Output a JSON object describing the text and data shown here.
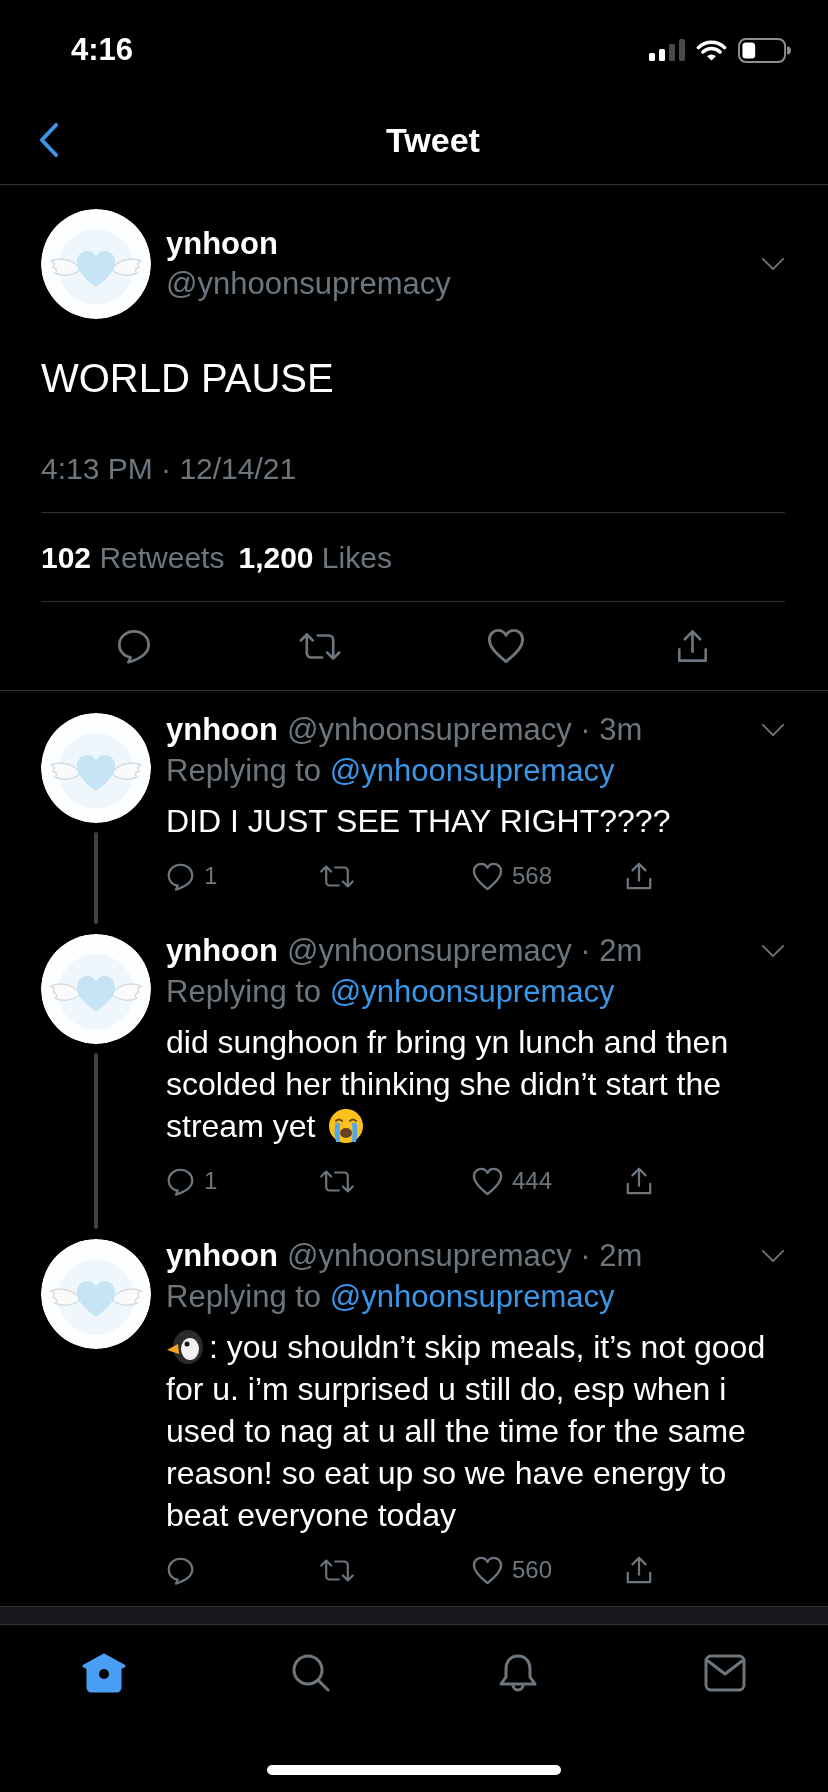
{
  "status_bar": {
    "time": "4:16"
  },
  "nav_bar": {
    "title": "Tweet"
  },
  "tweet": {
    "name": "ynhoon",
    "handle": "@ynhoonsupremacy",
    "text": "WORLD PAUSE",
    "timestamp": "4:13 PM · 12/14/21",
    "retweets": "**102** Retweets",
    "likes": "**1,200** Likes"
  },
  "replies": [
    {
      "name": "ynhoon",
      "meta": "@ynhoonsupremacy · 3m",
      "replying_to": "Replying to",
      "mention": "@ynhoonsupremacy",
      "content": [
        {
          "kind": "text",
          "text": "DID I JUST SEE THAY RIGHT????"
        }
      ],
      "reply_count": "1",
      "like_count": "568",
      "thread_continues": true
    },
    {
      "name": "ynhoon",
      "meta": "@ynhoonsupremacy · 2m",
      "replying_to": "Replying to",
      "mention": "@ynhoonsupremacy",
      "content": [
        {
          "kind": "text",
          "text": "did sunghoon fr bring yn lunch and then scolded her thinking she didn’t start the"
        },
        {
          "kind": "text",
          "text": "stream yet"
        },
        {
          "kind": "crying-face"
        }
      ],
      "reply_count": "1",
      "like_count": "444",
      "thread_continues": true
    },
    {
      "name": "ynhoon",
      "meta": "@ynhoonsupremacy · 2m",
      "replying_to": "Replying to",
      "mention": "@ynhoonsupremacy",
      "content": [
        {
          "kind": "penguin"
        },
        {
          "kind": "text",
          "text": ": you shouldn’t skip meals, it’s not good"
        },
        {
          "kind": "text",
          "text": "for u. i’m surprised u still do, esp when i used to nag at u all the time for the same reason! so eat up so we have energy to beat everyone today"
        }
      ],
      "like_count": "560",
      "thread_continues": false
    }
  ],
  "tab_bar": {
    "tabs": [
      {
        "kind": "home",
        "selected": true
      },
      {
        "kind": "search",
        "selected": false
      },
      {
        "kind": "notifications",
        "selected": false
      },
      {
        "kind": "messages",
        "selected": false
      }
    ]
  }
}
